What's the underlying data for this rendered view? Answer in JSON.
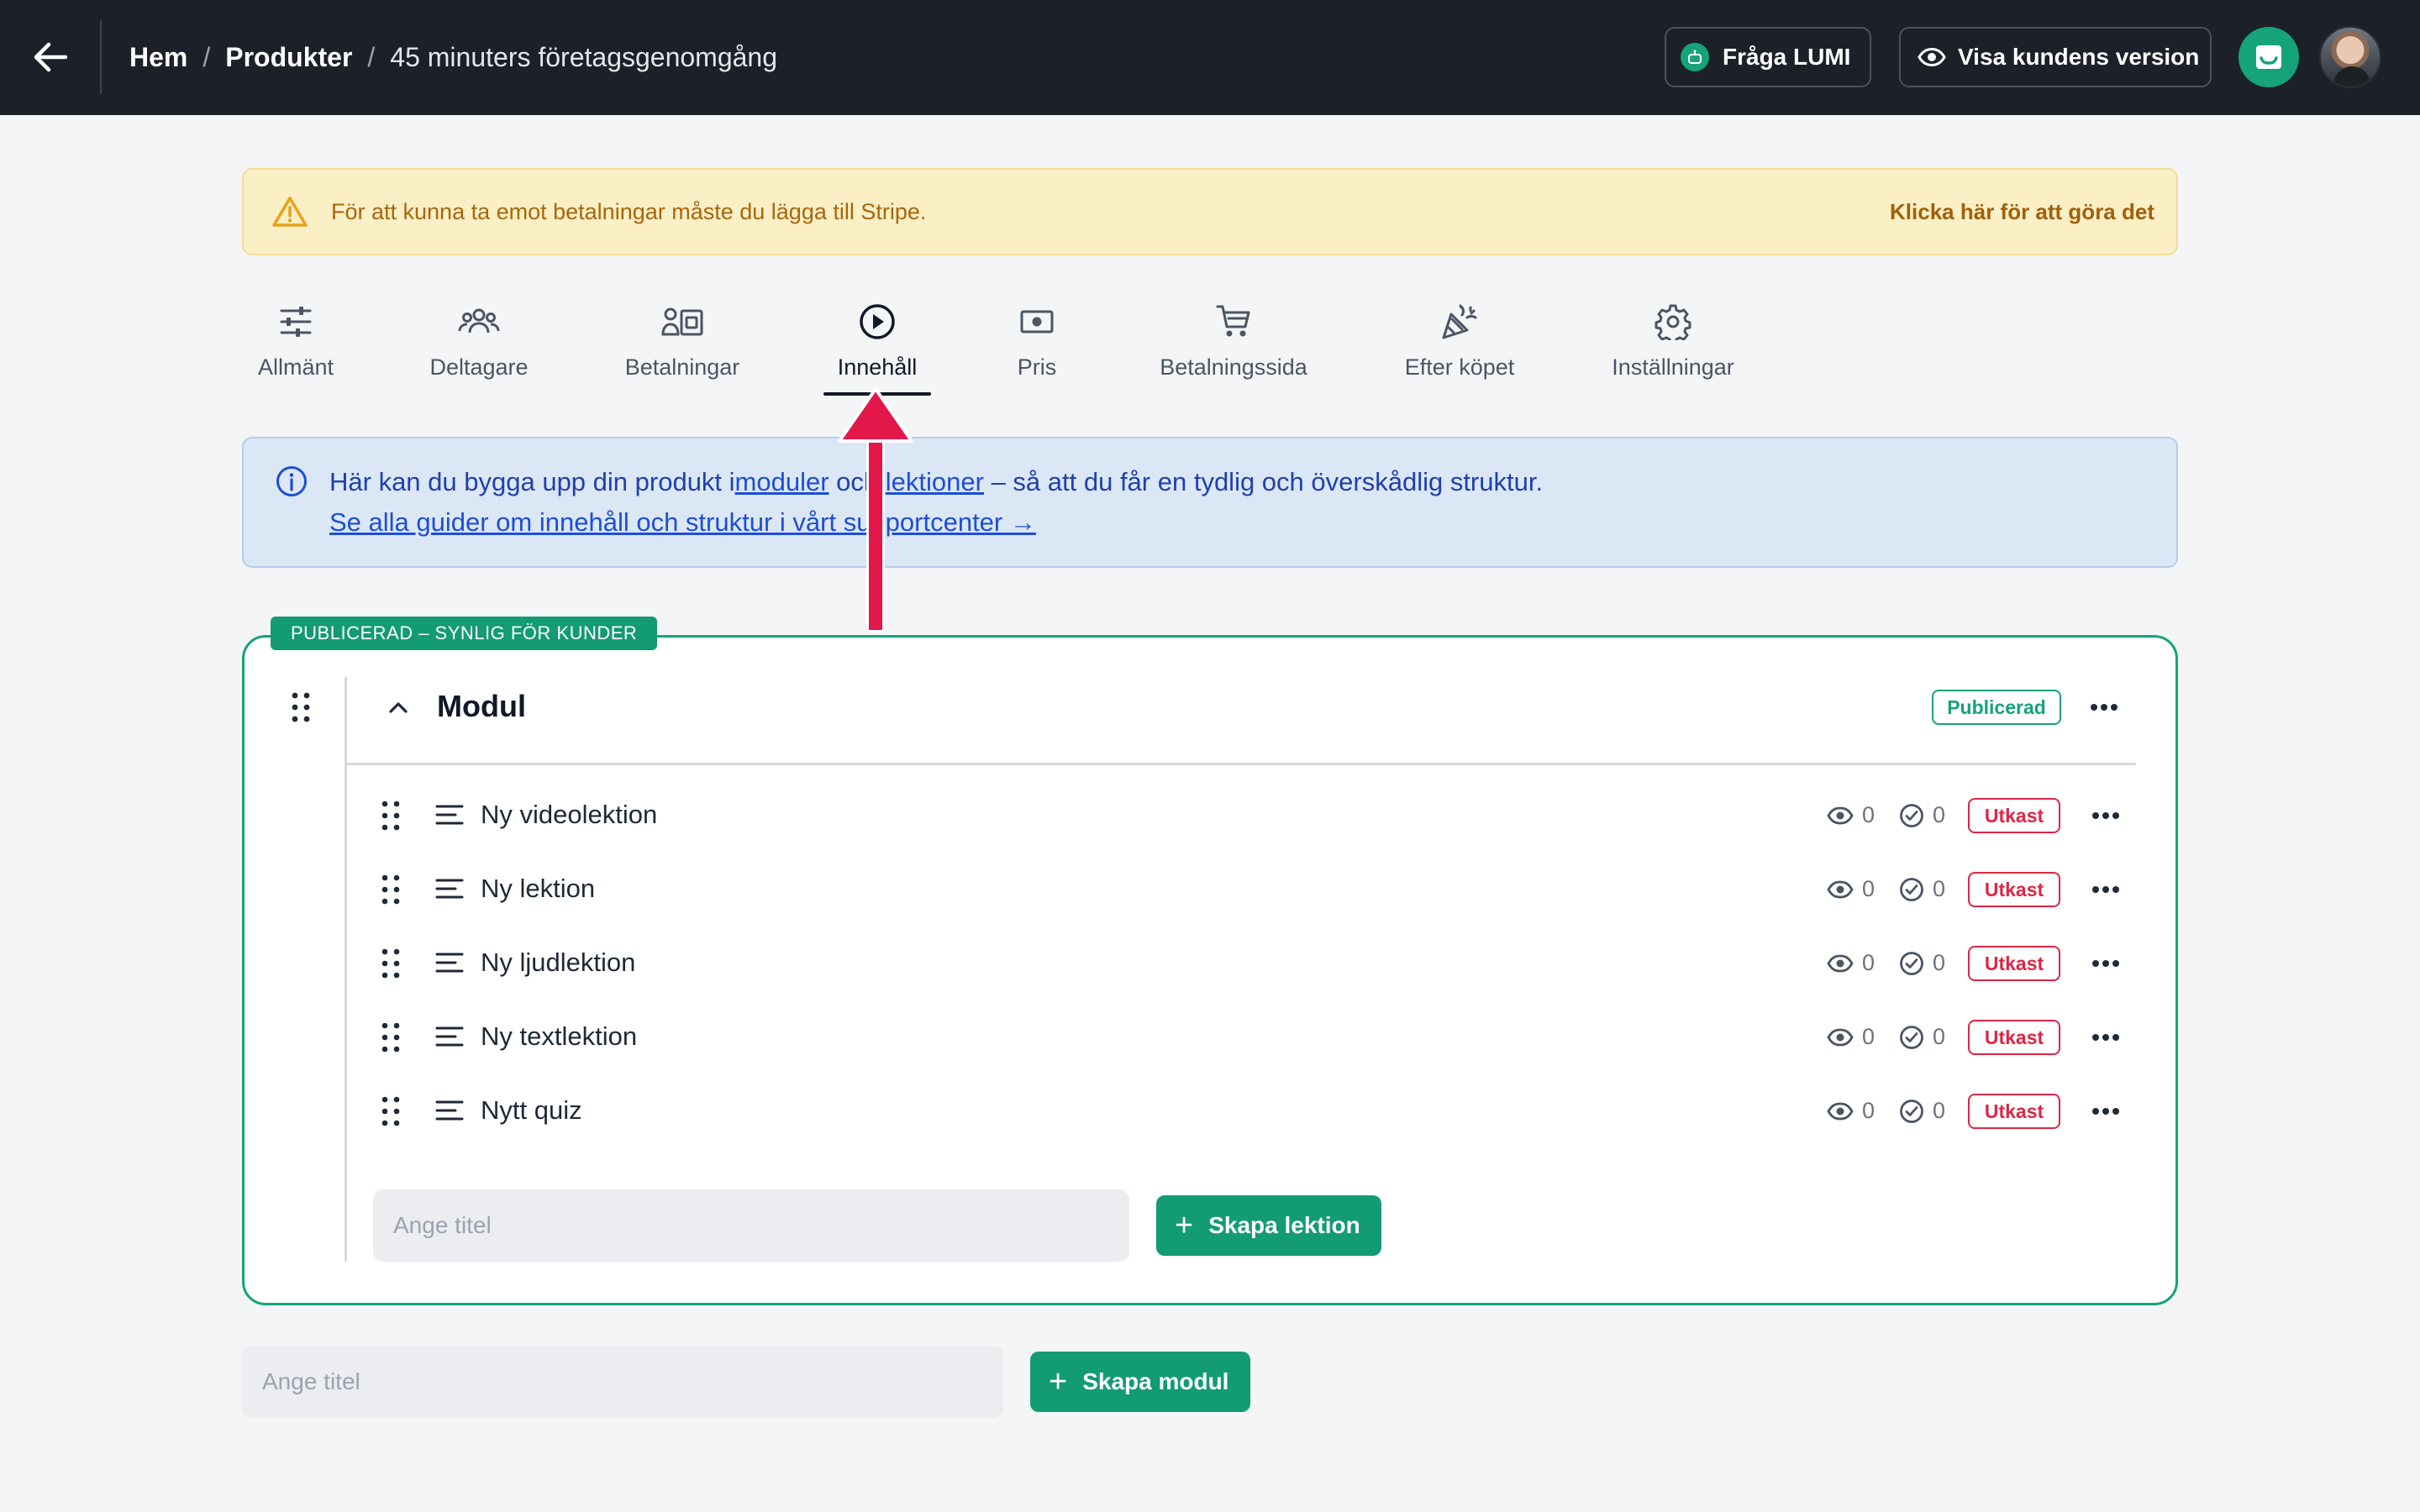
{
  "header": {
    "breadcrumb": {
      "home": "Hem",
      "products": "Produkter",
      "current": "45 minuters företagsgenomgång"
    },
    "separator": "/",
    "ask_lumi_label": "Fråga LUMI",
    "preview_label": "Visa kundens version"
  },
  "warning": {
    "text": "För att kunna ta emot betalningar måste du lägga till Stripe.",
    "link": "Klicka här för att göra det"
  },
  "tabs": [
    {
      "label": "Allmänt",
      "icon": "sliders-icon"
    },
    {
      "label": "Deltagare",
      "icon": "users-icon"
    },
    {
      "label": "Betalningar",
      "icon": "payments-icon"
    },
    {
      "label": "Innehåll",
      "icon": "play-circle-icon",
      "active": true
    },
    {
      "label": "Pris",
      "icon": "banknote-icon"
    },
    {
      "label": "Betalningssida",
      "icon": "cart-icon"
    },
    {
      "label": "Efter köpet",
      "icon": "party-popper-icon"
    },
    {
      "label": "Inställningar",
      "icon": "gear-icon"
    }
  ],
  "info": {
    "line1_pre": "Här kan du bygga upp din produkt i",
    "link_modules": "moduler",
    "line1_mid": " och ",
    "link_lessons": "lektioner",
    "line1_post": " – så att du får en tydlig och överskådlig struktur.",
    "line2": "Se alla guider om innehåll och struktur i vårt supportcenter →"
  },
  "module": {
    "published_tag": "PUBLICERAD – SYNLIG FÖR KUNDER",
    "title": "Modul",
    "status": "Publicerad",
    "lessons": [
      {
        "title": "Ny videolektion",
        "views": "0",
        "completed": "0",
        "status": "Utkast"
      },
      {
        "title": "Ny lektion",
        "views": "0",
        "completed": "0",
        "status": "Utkast"
      },
      {
        "title": "Ny ljudlektion",
        "views": "0",
        "completed": "0",
        "status": "Utkast"
      },
      {
        "title": "Ny textlektion",
        "views": "0",
        "completed": "0",
        "status": "Utkast"
      },
      {
        "title": "Nytt quiz",
        "views": "0",
        "completed": "0",
        "status": "Utkast"
      }
    ],
    "lesson_input_placeholder": "Ange titel",
    "create_lesson_label": "Skapa lektion"
  },
  "new_module": {
    "input_placeholder": "Ange titel",
    "create_module_label": "Skapa modul"
  },
  "colors": {
    "topbar": "#1b2029",
    "accent_green": "#16a37a",
    "draft_red": "#dc2646",
    "warning_bg": "#fbefc6",
    "info_bg": "#dce7f6",
    "annotation_arrow": "#e4174a"
  }
}
